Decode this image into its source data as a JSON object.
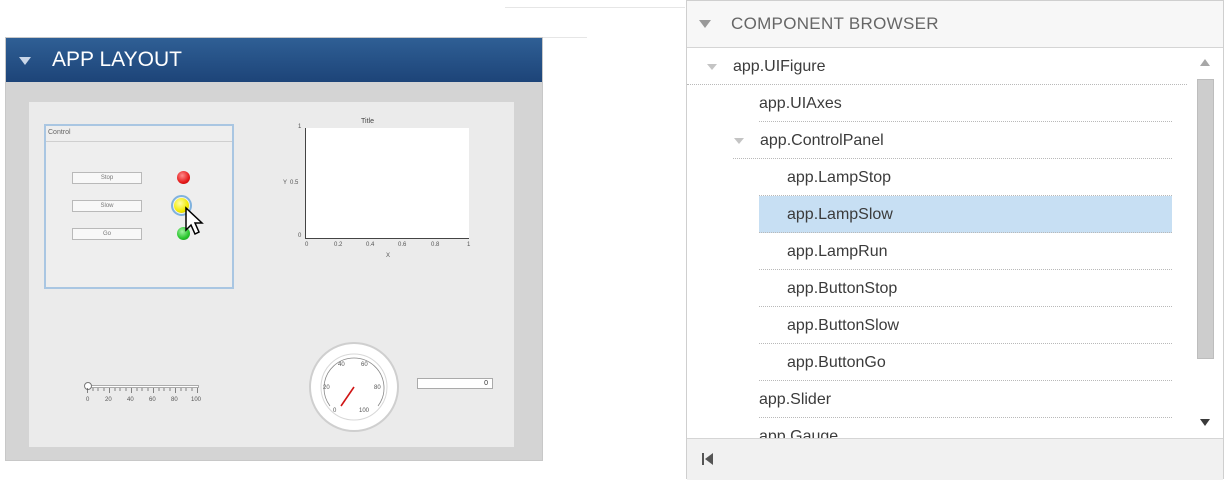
{
  "layout_panel": {
    "title": "APP LAYOUT",
    "control_panel": {
      "title": "Control",
      "buttons": [
        "Stop",
        "Slow",
        "Go"
      ],
      "lamp_colors": [
        "#e51b1b",
        "#f2ea00",
        "#27c52b"
      ]
    },
    "axes": {
      "title": "Title",
      "xlabel": "X",
      "ylabel": "Y",
      "y_ticks": [
        "1",
        "0.5",
        "0"
      ],
      "x_ticks": [
        "0",
        "0.2",
        "0.4",
        "0.6",
        "0.8",
        "1"
      ]
    },
    "slider": {
      "ticks": [
        "0",
        "20",
        "40",
        "60",
        "80",
        "100"
      ],
      "value": 0
    },
    "gauge": {
      "ticks": [
        "0",
        "20",
        "40",
        "60",
        "80",
        "100"
      ],
      "value": 0
    },
    "numeric_field": "0"
  },
  "component_browser": {
    "title": "COMPONENT BROWSER",
    "items": [
      {
        "label": "app.UIFigure",
        "level": 0,
        "expanded": true
      },
      {
        "label": "app.UIAxes",
        "level": 1
      },
      {
        "label": "app.ControlPanel",
        "level": 1,
        "expanded": true
      },
      {
        "label": "app.LampStop",
        "level": 2
      },
      {
        "label": "app.LampSlow",
        "level": 2,
        "selected": true
      },
      {
        "label": "app.LampRun",
        "level": 2
      },
      {
        "label": "app.ButtonStop",
        "level": 2
      },
      {
        "label": "app.ButtonSlow",
        "level": 2
      },
      {
        "label": "app.ButtonGo",
        "level": 2
      },
      {
        "label": "app.Slider",
        "level": 1
      },
      {
        "label": "app.Gauge",
        "level": 1
      }
    ],
    "selection_color": "#c7dff3",
    "footer_icon": "collapse-to-start-icon"
  }
}
